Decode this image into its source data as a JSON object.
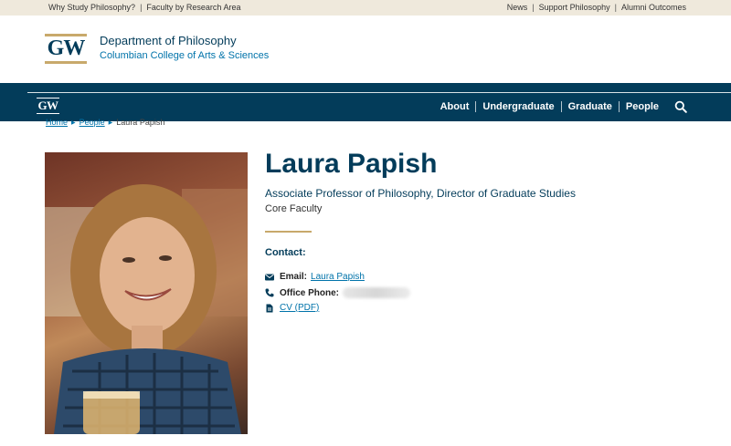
{
  "utility_bar": {
    "left_links": [
      "Why Study Philosophy?",
      "Faculty by Research Area"
    ],
    "right_links": [
      "News",
      "Support Philosophy",
      "Alumni Outcomes"
    ],
    "separator": "|"
  },
  "header": {
    "logo_text": "GW",
    "department": "Department of Philosophy",
    "college": "Columbian College of Arts & Sciences"
  },
  "nav": {
    "logo_text": "GW",
    "items": [
      "About",
      "Undergraduate",
      "Graduate",
      "People"
    ]
  },
  "breadcrumb": {
    "items": [
      "Home",
      "People",
      "Laura Papish"
    ]
  },
  "profile": {
    "name": "Laura Papish",
    "title": "Associate Professor of Philosophy, Director of Graduate Studies",
    "faculty_type": "Core Faculty",
    "contact_heading": "Contact:",
    "email_label": "Email:",
    "email_link": "Laura Papish",
    "phone_label": "Office Phone:",
    "cv_link": "CV (PDF)"
  },
  "colors": {
    "primary": "#033c5a",
    "accent_gold": "#c8a96b",
    "link": "#0073aa",
    "utility_bg": "#efe9dc"
  }
}
